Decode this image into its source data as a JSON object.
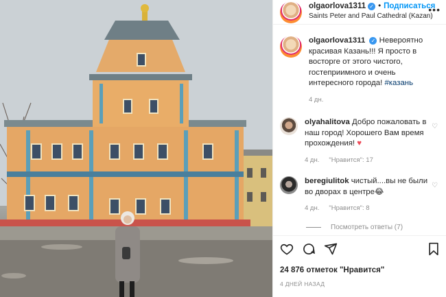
{
  "post": {
    "username": "olgaorlova1311",
    "follow_label": "Подписаться",
    "location": "Saints Peter and Paul Cathedral (Kazan)",
    "more_label": "•••"
  },
  "caption": {
    "username": "olgaorlova1311",
    "text": "Невероятно красивая Казань!!! Я просто в восторге от этого чистого, гостеприимного и очень интересного города!",
    "hashtag": "#казань",
    "time": "4 дн."
  },
  "comments": [
    {
      "username": "olyahalitova",
      "text": "Добро пожаловать в наш город! Хорошего Вам время прохождения!",
      "time": "4 дн.",
      "likes": "\"Нравится\": 17"
    },
    {
      "username": "beregiulitok",
      "text": "чистый....вы не были во дворах в центре😂",
      "time": "4 дн.",
      "likes": "\"Нравится\": 8"
    }
  ],
  "replies_label": "Посмотреть ответы (7)",
  "likes_count": "24 876 отметок \"Нравится\"",
  "posted_date": "4 ДНЕЙ НАЗАД",
  "icons": [
    "heart-icon",
    "comment-icon",
    "share-icon",
    "bookmark-icon",
    "verified-icon",
    "more-icon"
  ]
}
